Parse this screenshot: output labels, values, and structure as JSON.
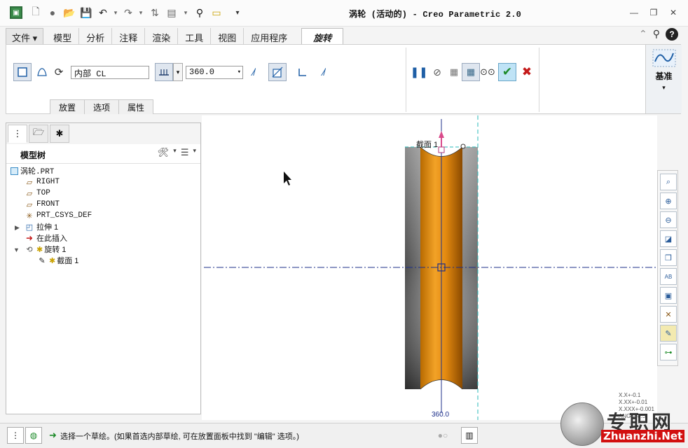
{
  "window": {
    "title": "涡轮 (活动的) - Creo Parametric 2.0"
  },
  "ribbon": {
    "tabs": [
      {
        "label": "文件",
        "id": "file"
      },
      {
        "label": "模型",
        "id": "model"
      },
      {
        "label": "分析",
        "id": "analysis"
      },
      {
        "label": "注释",
        "id": "annotate"
      },
      {
        "label": "渲染",
        "id": "render"
      },
      {
        "label": "工具",
        "id": "tools"
      },
      {
        "label": "视图",
        "id": "view"
      },
      {
        "label": "应用程序",
        "id": "apps"
      },
      {
        "label": "旋转",
        "id": "revolve"
      }
    ],
    "file_arrow": "▾"
  },
  "dashboard": {
    "axis_value": "内部 CL",
    "angle_value": "360.0",
    "subtabs": [
      "放置",
      "选项",
      "属性"
    ],
    "datum_label": "基准"
  },
  "model_tree": {
    "title": "模型树",
    "items": [
      {
        "label": "涡轮.PRT"
      },
      {
        "label": "RIGHT"
      },
      {
        "label": "TOP"
      },
      {
        "label": "FRONT"
      },
      {
        "label": "PRT_CSYS_DEF"
      },
      {
        "label": "拉伸 1"
      },
      {
        "label": "在此插入"
      },
      {
        "label": "旋转 1"
      },
      {
        "label": "截面 1"
      }
    ]
  },
  "graphics": {
    "section_label": "截面 1",
    "angle_dim": "360.0"
  },
  "status": {
    "message": "选择一个草绘。(如果首选内部草绘, 可在放置面板中找到 \"编辑\" 选项。)"
  },
  "watermark": {
    "cn": "专职网",
    "en": "Zhuanzhi.Net",
    "tolerances": [
      "X.X+-0.1",
      "X.XX+-0.01",
      "X.XXX+-0.001",
      "ANG.+-0.5"
    ]
  }
}
